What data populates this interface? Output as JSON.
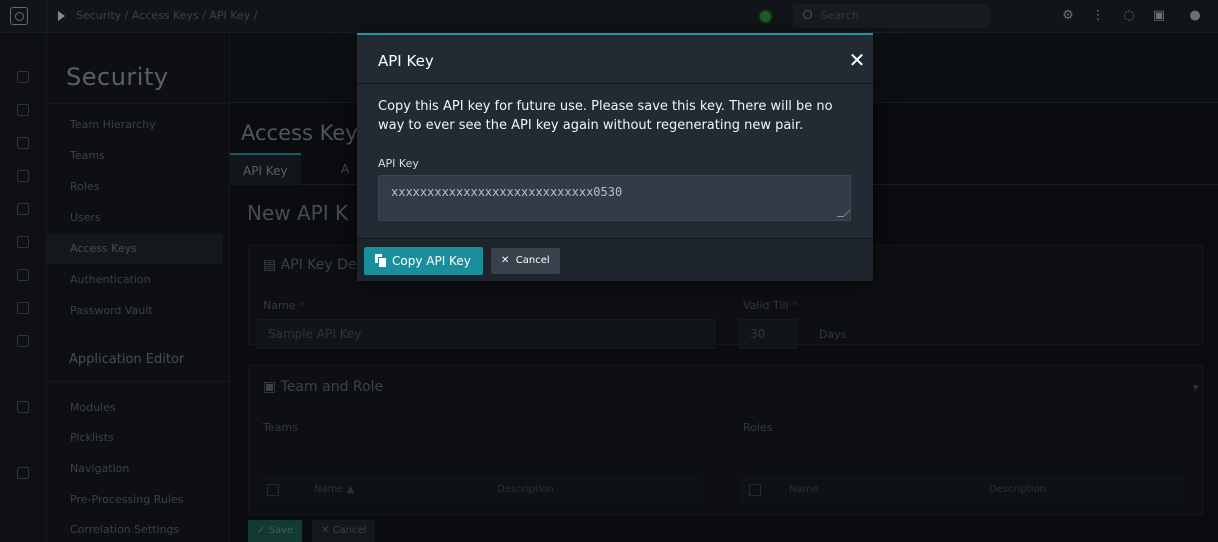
{
  "topbar": {
    "breadcrumb": "Security / Access Keys / API Key /",
    "search_placeholder": "Search",
    "icons": [
      "settings-icon",
      "hierarchy-icon",
      "bell-icon",
      "clipboard-icon",
      "user-icon"
    ]
  },
  "secnav": {
    "title": "Security",
    "items": [
      "Team Hierarchy",
      "Teams",
      "Roles",
      "Users",
      "Access Keys",
      "Authentication",
      "Password Vault"
    ],
    "active_item": "Access Keys",
    "app_editor_title": "Application Editor",
    "app_editor_items": [
      "Modules",
      "Picklists",
      "Navigation",
      "Pre-Processing Rules",
      "Correlation Settings"
    ]
  },
  "main": {
    "heading": "Access Keys",
    "tabs": [
      "API Key",
      "A"
    ],
    "subheading": "New API K",
    "details_title": "API Key De",
    "name_label": "Name",
    "name_value": "Sample API Key",
    "valid_till_label": "Valid Till",
    "valid_till_value": "30",
    "valid_till_unit": "Days",
    "team_role_title": "Team and Role",
    "teams_label": "Teams",
    "roles_label": "Roles",
    "col_name_sorted": "Name ▲",
    "col_description": "Description",
    "col_name": "Name",
    "save_label": "Save",
    "cancel_label": "Cancel"
  },
  "modal": {
    "title": "API Key",
    "close_glyph": "✕",
    "message": "Copy this API key for future use. Please save this key. There will be no way to ever see the API key again without regenerating new pair.",
    "field_label": "API Key",
    "field_value": "xxxxxxxxxxxxxxxxxxxxxxxxxxxx0530",
    "copy_label": "Copy API Key",
    "cancel_label": "Cancel"
  },
  "colors": {
    "accent": "#1b8e9b",
    "modal_bg": "#222a33",
    "status_online": "#2f8f3c"
  }
}
